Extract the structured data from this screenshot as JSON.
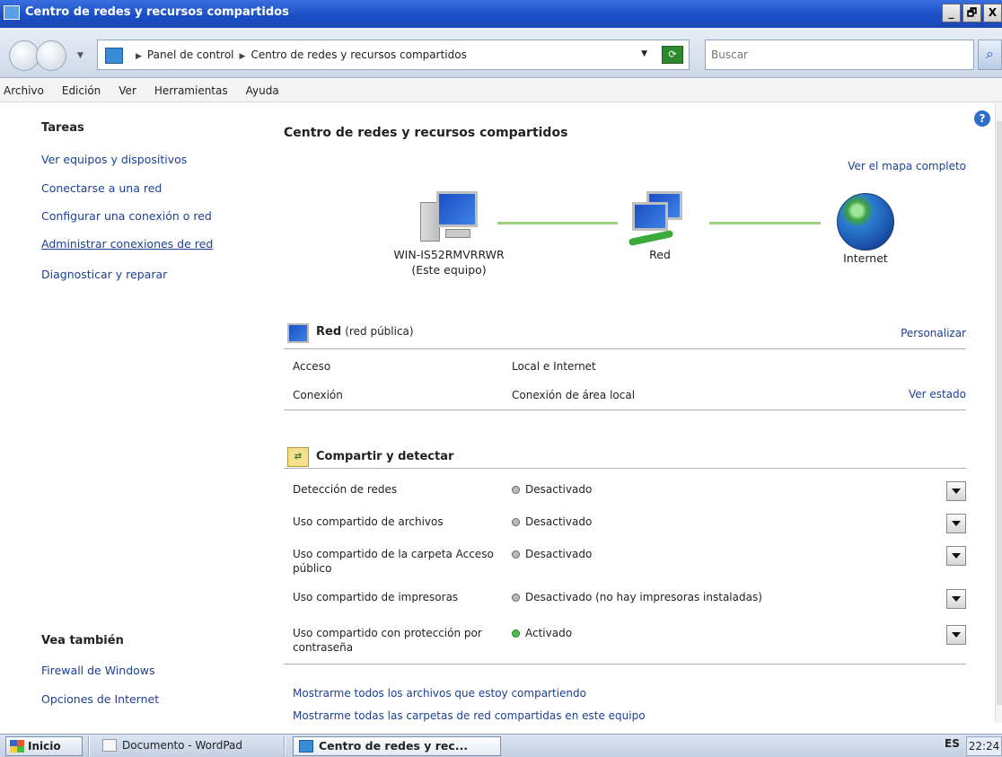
{
  "window": {
    "title": "Centro de redes y recursos compartidos",
    "min_label": "_",
    "max_label": "🗗",
    "close_label": "X"
  },
  "address": {
    "crumbs": [
      "Panel de control",
      "Centro de redes y recursos compartidos"
    ],
    "search_placeholder": "Buscar"
  },
  "menu": [
    "Archivo",
    "Edición",
    "Ver",
    "Herramientas",
    "Ayuda"
  ],
  "sidebar": {
    "tasks_title": "Tareas",
    "tasks": [
      {
        "label": "Ver equipos y dispositivos"
      },
      {
        "label": "Conectarse a una red"
      },
      {
        "label": "Configurar una conexión o red"
      },
      {
        "label": "Administrar conexiones de red"
      },
      {
        "label": "Diagnosticar y reparar"
      }
    ],
    "see_also_title": "Vea también",
    "see_also": [
      {
        "label": "Firewall de Windows"
      },
      {
        "label": "Opciones de Internet"
      }
    ]
  },
  "main": {
    "title": "Centro de redes y recursos compartidos",
    "full_map_link": "Ver el mapa completo",
    "map": {
      "computer_name": "WIN-IS52RMVRRWR",
      "computer_sub": "(Este equipo)",
      "network_label": "Red",
      "internet_label": "Internet"
    },
    "network": {
      "name": "Red",
      "type": "(red pública)",
      "customize": "Personalizar",
      "rows": [
        {
          "key": "Acceso",
          "value": "Local e Internet",
          "action": ""
        },
        {
          "key": "Conexión",
          "value": "Conexión de área local",
          "action": "Ver estado"
        }
      ]
    },
    "sharing": {
      "title": "Compartir y detectar",
      "rows": [
        {
          "key": "Detección de redes",
          "value": "Desactivado",
          "on": false
        },
        {
          "key": "Uso compartido de archivos",
          "value": "Desactivado",
          "on": false
        },
        {
          "key": "Uso compartido de la carpeta Acceso público",
          "value": "Desactivado",
          "on": false
        },
        {
          "key": "Uso compartido de impresoras",
          "value": "Desactivado (no hay impresoras instaladas)",
          "on": false
        },
        {
          "key": "Uso compartido con protección por contraseña",
          "value": "Activado",
          "on": true
        }
      ]
    },
    "links": [
      "Mostrarme todos los archivos que estoy compartiendo",
      "Mostrarme todas las carpetas de red compartidas en este equipo"
    ]
  },
  "taskbar": {
    "start": "Inicio",
    "tasks": [
      "Documento - WordPad",
      "Centro de redes y rec..."
    ],
    "lang": "ES",
    "clock": "22:24"
  }
}
